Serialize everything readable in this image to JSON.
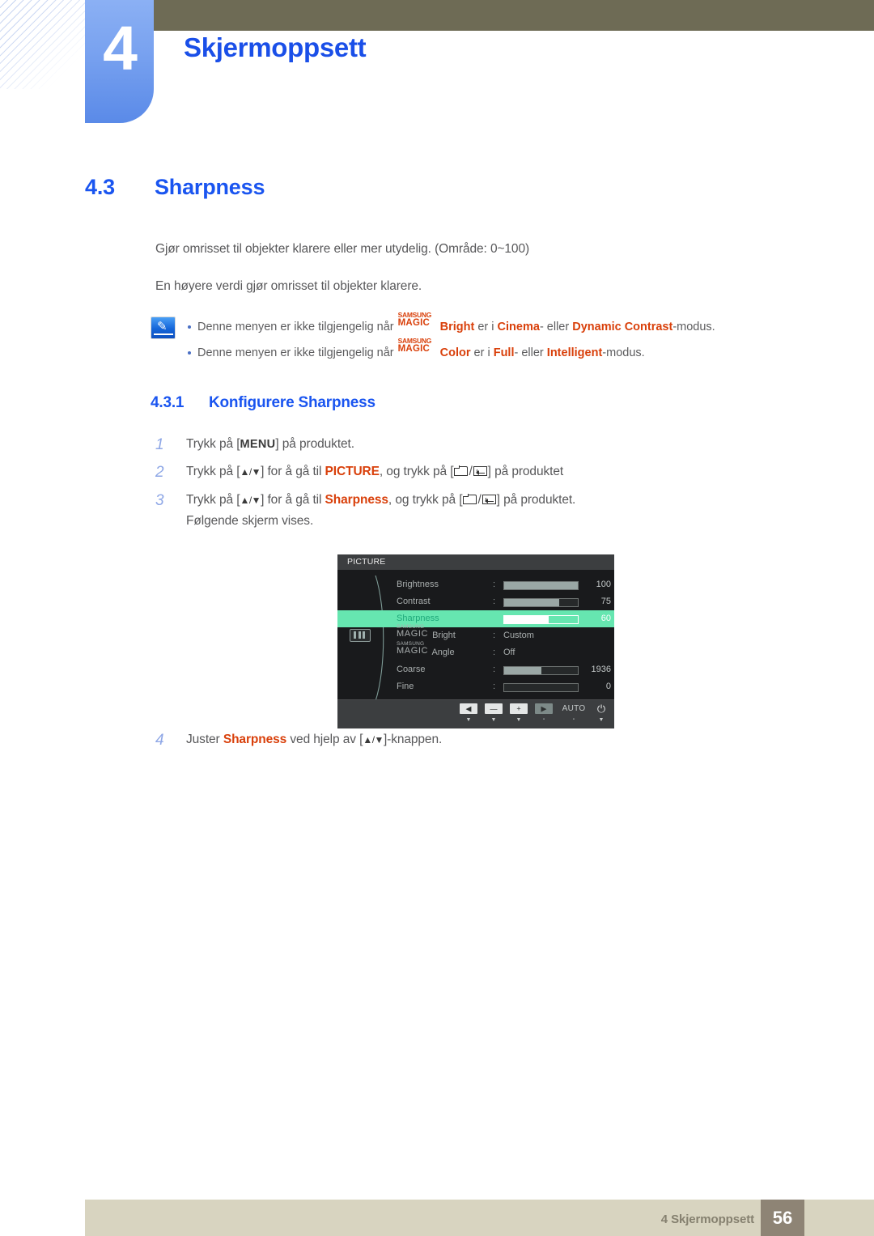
{
  "header": {
    "chapter_number": "4",
    "chapter_title": "Skjermoppsett"
  },
  "section": {
    "number": "4.3",
    "title": "Sharpness",
    "paragraph_1": "Gjør omrisset til objekter klarere eller mer utydelig. (Område: 0~100)",
    "paragraph_2": "En høyere verdi gjør omrisset til objekter klarere."
  },
  "note": {
    "icon": "note-pen-icon",
    "bullets": [
      {
        "lead": "Denne menyen er ikke tilgjengelig når",
        "magic_top": "SAMSUNG",
        "magic_bottom": "MAGIC",
        "feature": "Bright",
        "mid": " er i ",
        "mode_1": "Cinema",
        "sep": "- eller ",
        "mode_2": "Dynamic Contrast",
        "tail": "-modus."
      },
      {
        "lead": "Denne menyen er ikke tilgjengelig når",
        "magic_top": "SAMSUNG",
        "magic_bottom": "MAGIC",
        "feature": "Color",
        "mid": " er i ",
        "mode_1": "Full",
        "sep": "- eller ",
        "mode_2": "Intelligent",
        "tail": "-modus."
      }
    ]
  },
  "subsection": {
    "number": "4.3.1",
    "title": "Konfigurere Sharpness"
  },
  "steps": {
    "step1": {
      "n": "1",
      "pre": "Trykk på [",
      "key": "MENU",
      "post": "] på produktet."
    },
    "step2": {
      "n": "2",
      "pre": "Trykk på [",
      "arrows": "▲/▼",
      "mid": "] for å gå til ",
      "target": "PICTURE",
      "after": ", og trykk på [",
      "slash": "/",
      "tail": "] på produktet"
    },
    "step3": {
      "n": "3",
      "pre": "Trykk på [",
      "arrows": "▲/▼",
      "mid": "] for å gå til ",
      "target": "Sharpness",
      "after": ", og trykk på [",
      "slash": "/",
      "tail": "] på produktet.",
      "followup": "Følgende skjerm vises."
    },
    "step4": {
      "n": "4",
      "pre": "Juster ",
      "target": "Sharpness",
      "mid": " ved hjelp av [",
      "arrows": "▲/▼",
      "tail": "]-knappen."
    }
  },
  "osd": {
    "title": "PICTURE",
    "side_icon": "picture-bars-icon",
    "rows": [
      {
        "label": "Brightness",
        "colon": ":",
        "value": "100",
        "type": "slider",
        "percent": 100,
        "selected": false
      },
      {
        "label": "Contrast",
        "colon": ":",
        "value": "75",
        "type": "slider",
        "percent": 75,
        "selected": false
      },
      {
        "label": "Sharpness",
        "colon": ":",
        "value": "60",
        "type": "slider",
        "percent": 60,
        "selected": true
      },
      {
        "label": "Bright",
        "colon": ":",
        "value": "Custom",
        "type": "text",
        "magic_top": "SAMSUNG",
        "magic_bottom": "MAGIC",
        "selected": false
      },
      {
        "label": "Angle",
        "colon": ":",
        "value": "Off",
        "type": "text",
        "magic_top": "SAMSUNG",
        "magic_bottom": "MAGIC",
        "selected": false
      },
      {
        "label": "Coarse",
        "colon": ":",
        "value": "1936",
        "type": "slider",
        "percent": 50,
        "selected": false
      },
      {
        "label": "Fine",
        "colon": ":",
        "value": "0",
        "type": "slider",
        "percent": 0,
        "selected": false
      }
    ],
    "footer_buttons": [
      {
        "name": "back-button",
        "glyph": "◀",
        "tag": "▼",
        "style": "light"
      },
      {
        "name": "minus-button",
        "glyph": "—",
        "tag": "▼",
        "style": "light"
      },
      {
        "name": "plus-button",
        "glyph": "+",
        "tag": "▼",
        "style": "light"
      },
      {
        "name": "enter-button",
        "glyph": "▶",
        "tag": "▪",
        "style": "dim"
      },
      {
        "name": "auto-button",
        "label": "AUTO",
        "tag": "▪"
      },
      {
        "name": "power-button",
        "glyph": "⏻",
        "tag": "▼"
      }
    ]
  },
  "footer": {
    "text": "4 Skjermoppsett",
    "page": "56"
  },
  "colors": {
    "heading_blue": "#1a55f0",
    "chapter_blue": "#1a4fe8",
    "accent_orange": "#d9400b",
    "topbar_olive": "#6e6b55",
    "footer_beige": "#d8d4c0",
    "page_badge": "#8e8475",
    "osd_highlight": "#66e6b0",
    "osd_bg": "#191a1c"
  }
}
